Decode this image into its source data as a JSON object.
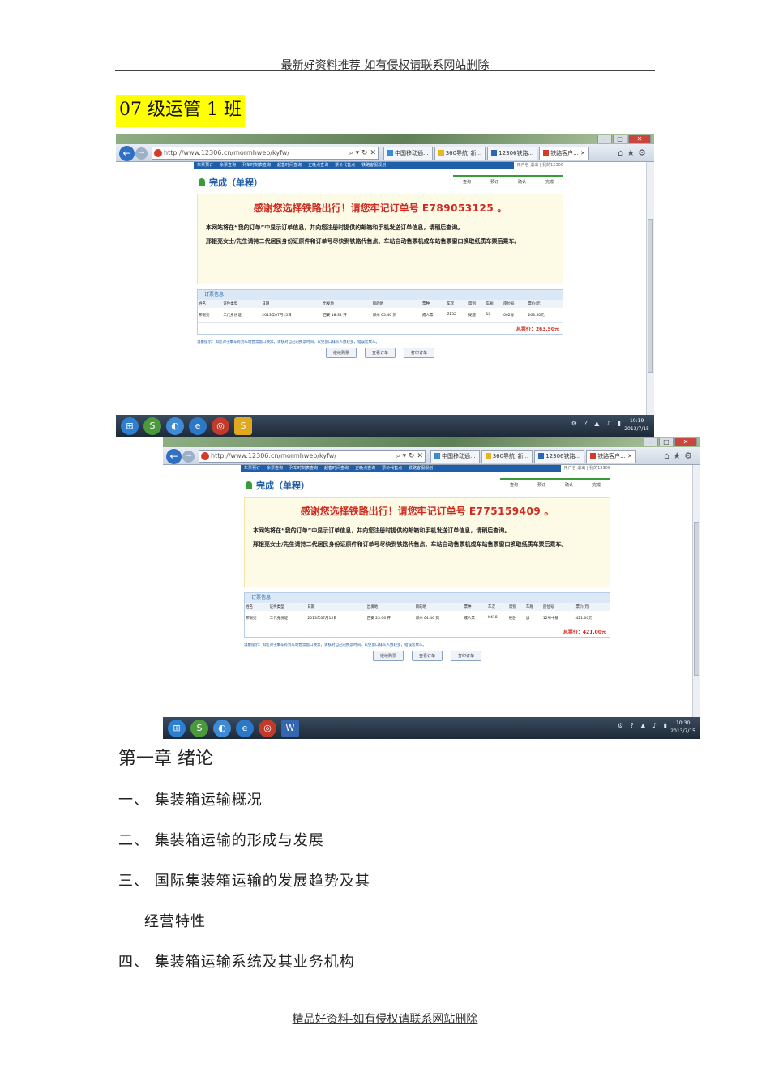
{
  "header": {
    "text": "最新好资料推荐-如有侵权请联系网站删除"
  },
  "footer": {
    "text": "精品好资料-如有侵权请联系网站删除"
  },
  "class_label": "07 级运管 1 班",
  "screenshots": [
    {
      "url": "http://www.12306.cn/mormhweb/kyfw/",
      "tabs": [
        "中国移动通...",
        "360导航_新...",
        "12306铁路...",
        "铁路客户..."
      ],
      "site_nav": [
        "车票预订",
        "余票查询",
        "列车时刻表查询",
        "起售时间查询",
        "正晚点查询",
        "票价代售点",
        "铁路客服规划"
      ],
      "site_nav_right": "用户名   退出   |   我的12306",
      "done_title": "完成（单程）",
      "steps": [
        "查询",
        "预订",
        "确认",
        "完成"
      ],
      "thanks_prefix": "感谢您选择铁路出行！请您",
      "thanks_stamp": "牢记",
      "thanks_label": "订单号",
      "order_no": "E789053125",
      "thanks_suffix": "。",
      "notice1": "本网站将在“我的订单”中显示订单信息，并向您注册时提供的邮箱和手机发送订单信息，请稍后查询。",
      "notice2": "邢银亮女士/先生请持二代居民身份证原件和订单号尽快到铁路代售点、车站自动售票机或车站售票窗口换取纸质车票后乘车。",
      "order_section": "订票信息",
      "columns": [
        "姓名",
        "证件类型",
        "日期",
        "出发地",
        "目的地",
        "票种",
        "车次",
        "席别",
        "车厢",
        "座位号",
        "票价(元)"
      ],
      "row": [
        "邢银亮",
        "二代身份证",
        "2013年07月15日",
        "西安 18:34 开",
        "郑州 05:40 到",
        "成人票",
        "Z132",
        "硬座",
        "18",
        "002号",
        "263.50元"
      ],
      "total": "总票价：263.50元",
      "tip": "温馨提示：如您对于乘车有到车站售票窗口换票，请核对自己的换票时间，以免窗口排队人数较多，错误您乘车。",
      "buttons": [
        "继续购票",
        "查看订单",
        "打印订单"
      ],
      "clock_time": "10:19",
      "clock_date": "2013/7/15"
    },
    {
      "url": "http://www.12306.cn/mormhweb/kyfw/",
      "tabs": [
        "中国移动通...",
        "360导航_新...",
        "12306铁路...",
        "铁路客户..."
      ],
      "site_nav": [
        "车票预订",
        "余票查询",
        "列车时刻表查询",
        "起售时间查询",
        "正晚点查询",
        "票价代售点",
        "铁路客服规划"
      ],
      "site_nav_right": "用户名   退出   |   我的12306",
      "done_title": "完成（单程）",
      "steps": [
        "查询",
        "预订",
        "确认",
        "完成"
      ],
      "thanks_prefix": "感谢您选择铁路出行！请您",
      "thanks_stamp": "牢记",
      "thanks_label": "订单号",
      "order_no": "E775159409",
      "thanks_suffix": "。",
      "notice1": "本网站将在“我的订单”中显示订单信息，并向您注册时提供的邮箱和手机发送订单信息，请稍后查询。",
      "notice2": "邢银亮女士/先生请持二代居民身份证原件和订单号尽快到铁路代售点、车站自动售票机或车站售票窗口换取纸质车票后乘车。",
      "order_section": "订票信息",
      "columns": [
        "姓名",
        "证件类型",
        "日期",
        "出发地",
        "目的地",
        "票种",
        "车次",
        "席别",
        "车厢",
        "座位号",
        "票价(元)"
      ],
      "row": [
        "邢银亮",
        "二代身份证",
        "2013年07月15日",
        "西安 23:06 开",
        "郑州 04:40 到",
        "成人票",
        "K418",
        "硬卧",
        "加",
        "12号中铺",
        "421.00元"
      ],
      "total": "总票价：421.00元",
      "tip": "温馨提示：如您对于乘车有到车站售票窗口换票，请核对自己的换票时间，以免窗口排队人数较多，错误您乘车。",
      "buttons": [
        "继续购票",
        "查看订单",
        "打印订单"
      ],
      "clock_time": "10:30",
      "clock_date": "2013/7/15"
    }
  ],
  "chapter_title": "第一章 绪论",
  "outline": [
    "一、 集装箱运输概况",
    "二、 集装箱运输的形成与发展",
    "三、 国际集装箱运输的发展趋势及其",
    "经营特性",
    "四、 集装箱运输系统及其业务机构"
  ]
}
